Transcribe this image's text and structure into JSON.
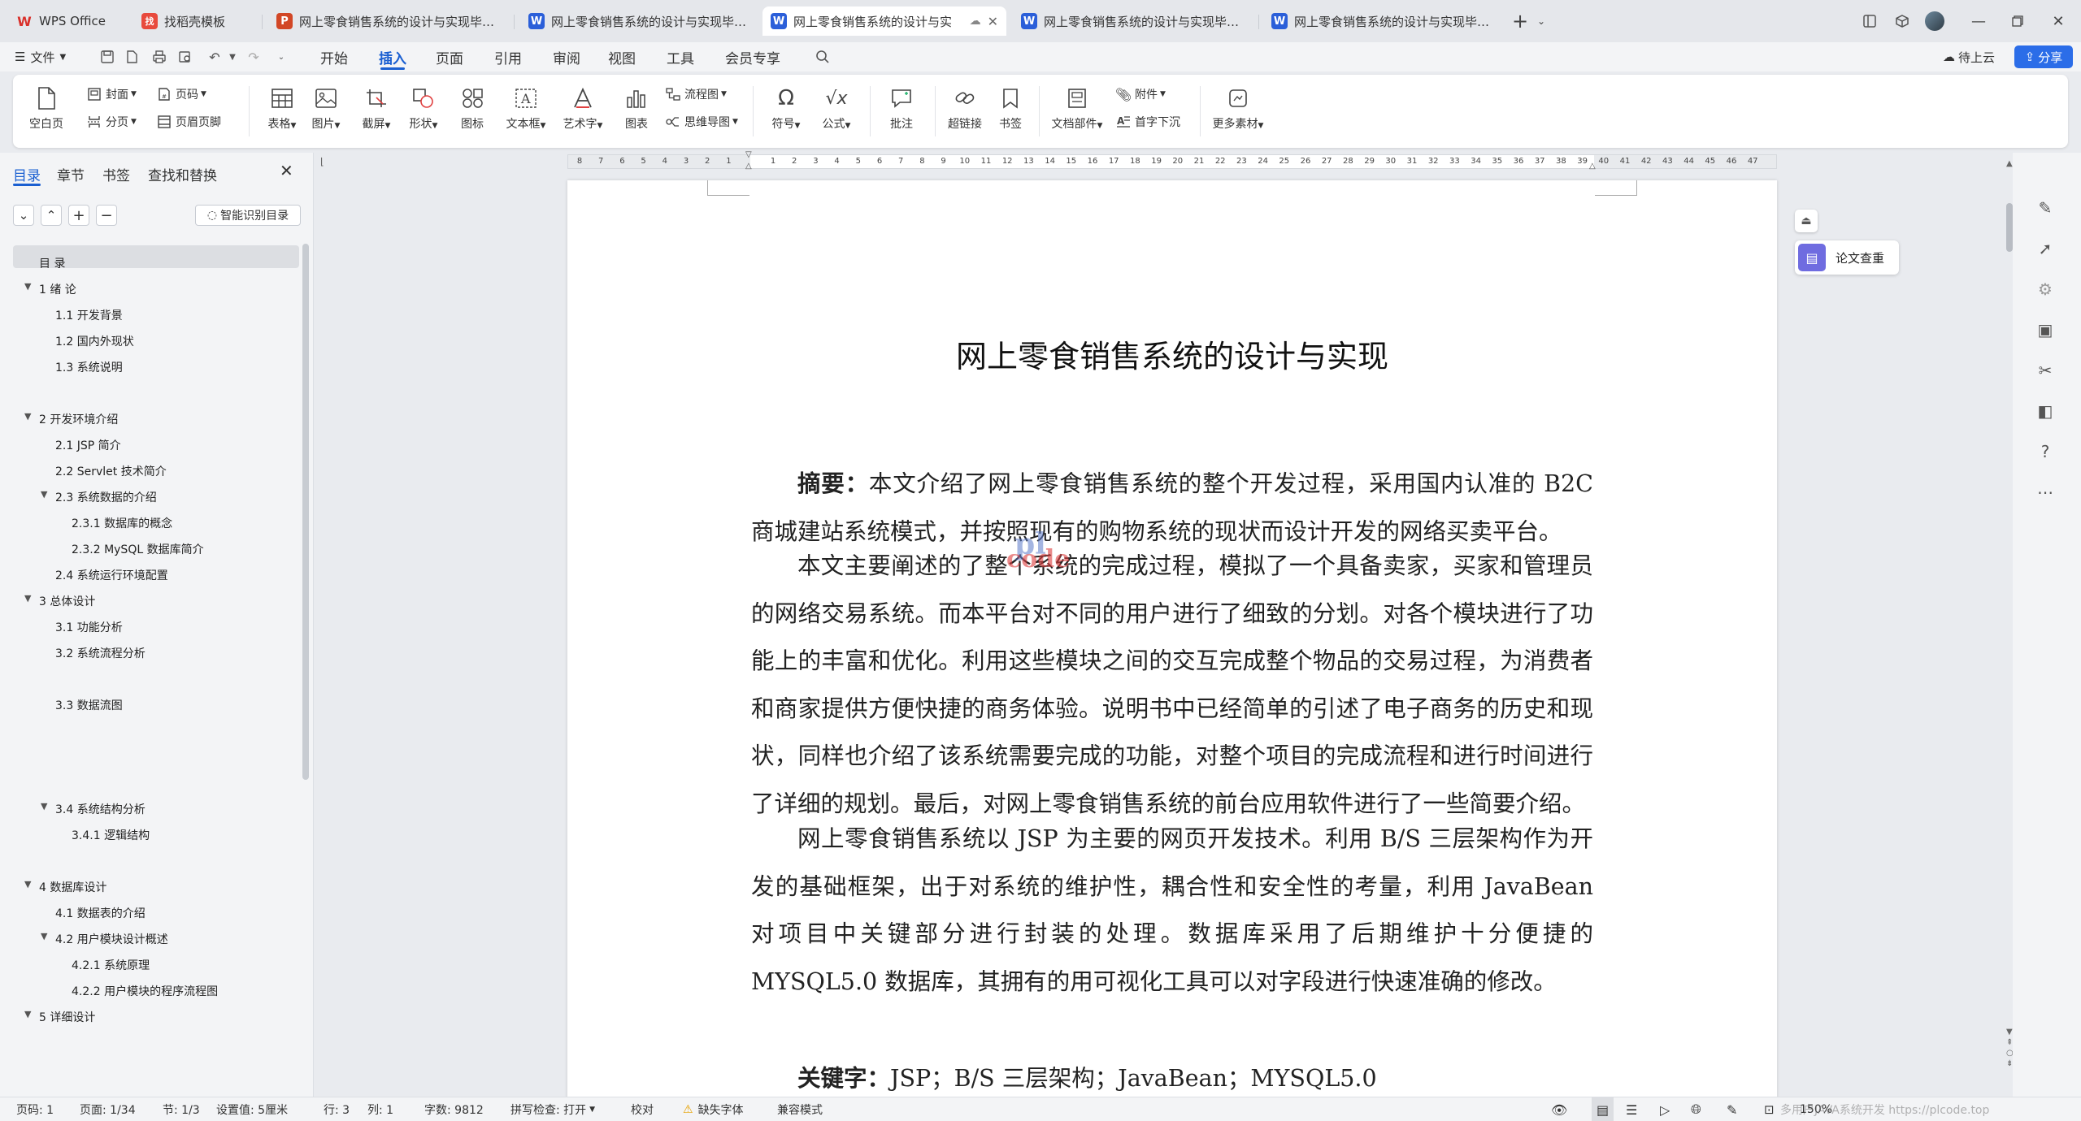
{
  "tabs": [
    {
      "icon": "W",
      "icon_color": "#d9302a",
      "label": "WPS Office"
    },
    {
      "icon": "找",
      "icon_color": "#e84a3d",
      "label": "找稻壳模板"
    },
    {
      "icon": "P",
      "icon_color": "#d24726",
      "label": "网上零食销售系统的设计与实现毕业设"
    },
    {
      "icon": "W",
      "icon_color": "#2b5fd9",
      "label": "网上零食销售系统的设计与实现毕业设"
    },
    {
      "icon": "W",
      "icon_color": "#2b5fd9",
      "label": "网上零食销售系统的设计与实"
    },
    {
      "icon": "W",
      "icon_color": "#2b5fd9",
      "label": "网上零食销售系统的设计与实现毕业设"
    },
    {
      "icon": "W",
      "icon_color": "#2b5fd9",
      "label": "网上零食销售系统的设计与实现毕业设"
    }
  ],
  "menu": {
    "file": "文件",
    "items": [
      "开始",
      "插入",
      "页面",
      "引用",
      "审阅",
      "视图",
      "工具",
      "会员专享"
    ],
    "active": "插入",
    "cloud": "待上云",
    "share": "分享"
  },
  "ribbon": {
    "blank_page": "空白页",
    "cover": "封面",
    "page_break": "分页",
    "page_num": "页码",
    "header_footer": "页眉页脚",
    "table": "表格",
    "picture": "图片",
    "screenshot": "截屏",
    "shape": "形状",
    "icon": "图标",
    "textbox": "文本框",
    "wordart": "艺术字",
    "chart": "图表",
    "flowchart": "流程图",
    "mindmap": "思维导图",
    "symbol": "符号",
    "formula": "公式",
    "comment": "批注",
    "hyperlink": "超链接",
    "bookmark": "书签",
    "doc_parts": "文档部件",
    "attachment": "附件",
    "dropcap": "首字下沉",
    "more": "更多素材"
  },
  "panel": {
    "tabs": [
      "目录",
      "章节",
      "书签",
      "查找和替换"
    ],
    "smart_toc": "智能识别目录",
    "toc": [
      {
        "level": 0,
        "text": "目  录",
        "arrow": ""
      },
      {
        "level": 0,
        "text": "1 绪 论",
        "arrow": "▼"
      },
      {
        "level": 1,
        "text": "1.1 开发背景",
        "arrow": ""
      },
      {
        "level": 1,
        "text": "1.2 国内外现状",
        "arrow": ""
      },
      {
        "level": 1,
        "text": "1.3 系统说明",
        "arrow": ""
      },
      {
        "level": 0,
        "text": "2 开发环境介绍",
        "arrow": "▼"
      },
      {
        "level": 1,
        "text": "2.1 JSP 简介",
        "arrow": ""
      },
      {
        "level": 1,
        "text": "2.2 Servlet 技术简介",
        "arrow": ""
      },
      {
        "level": 1,
        "text": "2.3 系统数据的介绍",
        "arrow": "▼"
      },
      {
        "level": 2,
        "text": "2.3.1 数据库的概念",
        "arrow": ""
      },
      {
        "level": 2,
        "text": "2.3.2 MySQL 数据库简介",
        "arrow": ""
      },
      {
        "level": 1,
        "text": "2.4 系统运行环境配置",
        "arrow": ""
      },
      {
        "level": 0,
        "text": "3 总体设计",
        "arrow": "▼"
      },
      {
        "level": 1,
        "text": "3.1 功能分析",
        "arrow": ""
      },
      {
        "level": 1,
        "text": "3.2 系统流程分析",
        "arrow": ""
      },
      {
        "level": 1,
        "text": "3.3 数据流图",
        "arrow": ""
      },
      {
        "level": 1,
        "text": "3.4 系统结构分析",
        "arrow": "▼"
      },
      {
        "level": 2,
        "text": "3.4.1 逻辑结构",
        "arrow": ""
      },
      {
        "level": 0,
        "text": "4 数据库设计",
        "arrow": "▼"
      },
      {
        "level": 1,
        "text": "4.1 数据表的介绍",
        "arrow": ""
      },
      {
        "level": 1,
        "text": "4.2 用户模块设计概述",
        "arrow": "▼"
      },
      {
        "level": 2,
        "text": "4.2.1 系统原理",
        "arrow": ""
      },
      {
        "level": 2,
        "text": "4.2.2 用户模块的程序流程图",
        "arrow": ""
      },
      {
        "level": 0,
        "text": "5 详细设计",
        "arrow": "▼"
      }
    ]
  },
  "ruler": {
    "left_numbers": [
      "8",
      "7",
      "6",
      "5",
      "4",
      "3",
      "2",
      "1"
    ],
    "right_numbers": [
      "1",
      "2",
      "3",
      "4",
      "5",
      "6",
      "7",
      "8",
      "9",
      "10",
      "11",
      "12",
      "13",
      "14",
      "15",
      "16",
      "17",
      "18",
      "19",
      "20",
      "21",
      "22",
      "23",
      "24",
      "25",
      "26",
      "27",
      "28",
      "29",
      "30",
      "31",
      "32",
      "33",
      "34",
      "35",
      "36",
      "37",
      "38",
      "39",
      "40",
      "41",
      "42",
      "43",
      "44",
      "45",
      "46",
      "47"
    ]
  },
  "document": {
    "title": "网上零食销售系统的设计与实现",
    "abstract_label": "摘要：",
    "p1": "本文介绍了网上零食销售系统的整个开发过程，采用国内认准的 B2C 商城建站系统模式，并按照现有的购物系统的现状而设计开发的网络买卖平台。",
    "p2": "本文主要阐述的了整个系统的完成过程，模拟了一个具备卖家，买家和管理员的网络交易系统。而本平台对不同的用户进行了细致的分划。对各个模块进行了功能上的丰富和优化。利用这些模块之间的交互完成整个物品的交易过程，为消费者和商家提供方便快捷的商务体验。说明书中已经简单的引述了电子商务的历史和现状，同样也介绍了该系统需要完成的功能，对整个项目的完成流程和进行时间进行了详细的规划。最后，对网上零食销售系统的前台应用软件进行了一些简要介绍。",
    "p3": "网上零食销售系统以 JSP 为主要的网页开发技术。利用 B/S 三层架构作为开发的基础框架，出于对系统的维护性，耦合性和安全性的考量，利用 JavaBean 对项目中关键部分进行封装的处理。数据库采用了后期维护十分便捷的 MYSQL5.0 数据库，其拥有的用可视化工具可以对字段进行快速准确的修改。",
    "keywords_label": "关键字：",
    "keywords": "JSP；B/S 三层架构；JavaBean；MYSQL5.0",
    "watermark_top": "pl",
    "watermark_bottom": "code"
  },
  "side": {
    "paper_check": "论文查重"
  },
  "status": {
    "page_no": "页码: 1",
    "page": "页面: 1/34",
    "section": "节: 1/3",
    "setting": "设置值: 5厘米",
    "row": "行: 3",
    "col": "列: 1",
    "words": "字数: 9812",
    "spell": "拼写检查: 打开",
    "proof": "校对",
    "missing_font": "缺失字体",
    "compat": "兼容模式",
    "zoom": "150%",
    "watermark_text": "多用户JAVA系统开发 https://plcode.top"
  }
}
